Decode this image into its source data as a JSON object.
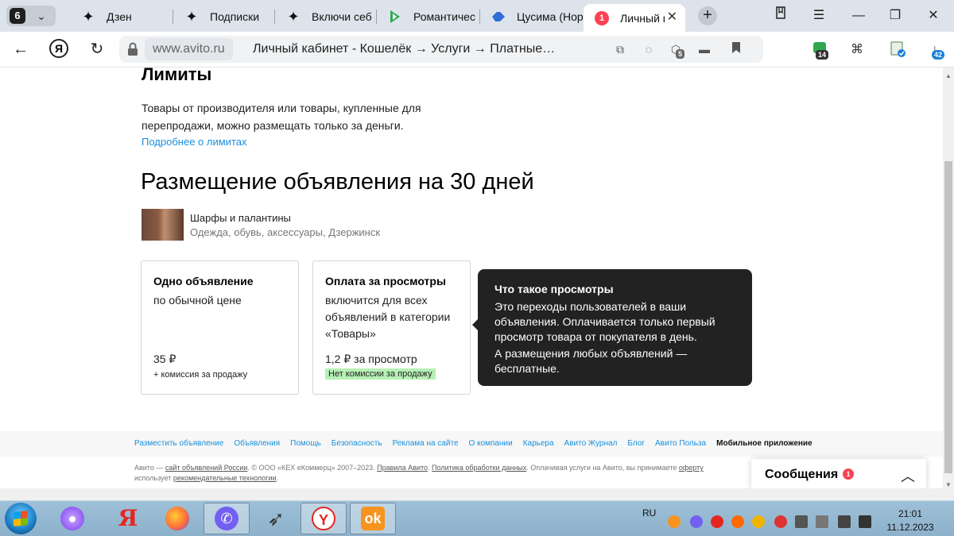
{
  "browser": {
    "tab_count": "6",
    "tabs": [
      {
        "title": "Дзен",
        "icon": "zen-star-icon"
      },
      {
        "title": "Подписки",
        "icon": "zen-star-icon"
      },
      {
        "title": "Включи себ",
        "icon": "zen-star-icon"
      },
      {
        "title": "Романтичес",
        "icon": "green-arrow-icon"
      },
      {
        "title": "Цусима (Нор",
        "icon": "blue-tshirt-icon"
      },
      {
        "title": "Личный к",
        "icon": "avito-badge-icon",
        "badge": "1",
        "active": true
      }
    ],
    "domain": "www.avito.ru",
    "url_title": "Личный кабинет - Кошелёк → Услуги → Платные…",
    "shield_count": "5",
    "ext_badge_1": "14",
    "downloads_badge": "42"
  },
  "page": {
    "limits": {
      "heading": "Лимиты",
      "text": "Товары от производителя или товары, купленные для перепродажи, можно размещать только за деньги.",
      "link": "Подробнее о лимитах"
    },
    "main_heading": "Размещение объявления на 30 дней",
    "item": {
      "title": "Шарфы и палантины",
      "subtitle": "Одежда, обувь, аксессуары, Дзержинск"
    },
    "cards": [
      {
        "title": "Одно объявление",
        "subtitle": "по обычной цене",
        "price": "35 ₽",
        "note": "+ комиссия за продажу"
      },
      {
        "title": "Оплата за просмотры",
        "subtitle": "включится для всех объявлений в категории «Товары»",
        "price": "1,2 ₽ за просмотр",
        "note": "Нет комиссии за продажу"
      }
    ],
    "tooltip": {
      "title": "Что такое просмотры",
      "p1": "Это переходы пользователей в ваши объявления. Оплачивается только первый просмотр товара от покупателя в день.",
      "p2": "А размещения любых объявлений — бесплатные."
    },
    "footer": {
      "links": [
        "Разместить объявление",
        "Объявления",
        "Помощь",
        "Безопасность",
        "Реклама на сайте",
        "О компании",
        "Карьера",
        "Авито Журнал",
        "Блог",
        "Авито Польза"
      ],
      "mobile_link": "Мобильное приложение",
      "legal_1": "Авито — ",
      "legal_link_1": "сайт объявлений России",
      "legal_2": ". © ООО «КЕХ еКоммерц» 2007–2023. ",
      "legal_link_2": "Правила Авито",
      "legal_3": ". ",
      "legal_link_3": "Политика обработки данных",
      "legal_4": ". Оплачивая услуги на Авито, вы принимаете ",
      "legal_link_4": "оферту",
      "legal_5": "использует ",
      "legal_link_5": "рекомендательные технологии",
      "legal_6": "."
    },
    "messages": {
      "label": "Сообщения",
      "count": "1"
    }
  },
  "taskbar": {
    "lang": "RU",
    "time": "21:01",
    "date": "11.12.2023"
  },
  "colors": {
    "link": "#1a8fdd",
    "tooltip_bg": "#222222",
    "green_badge": "#b7f0b5",
    "notify_red": "#ff4053"
  }
}
